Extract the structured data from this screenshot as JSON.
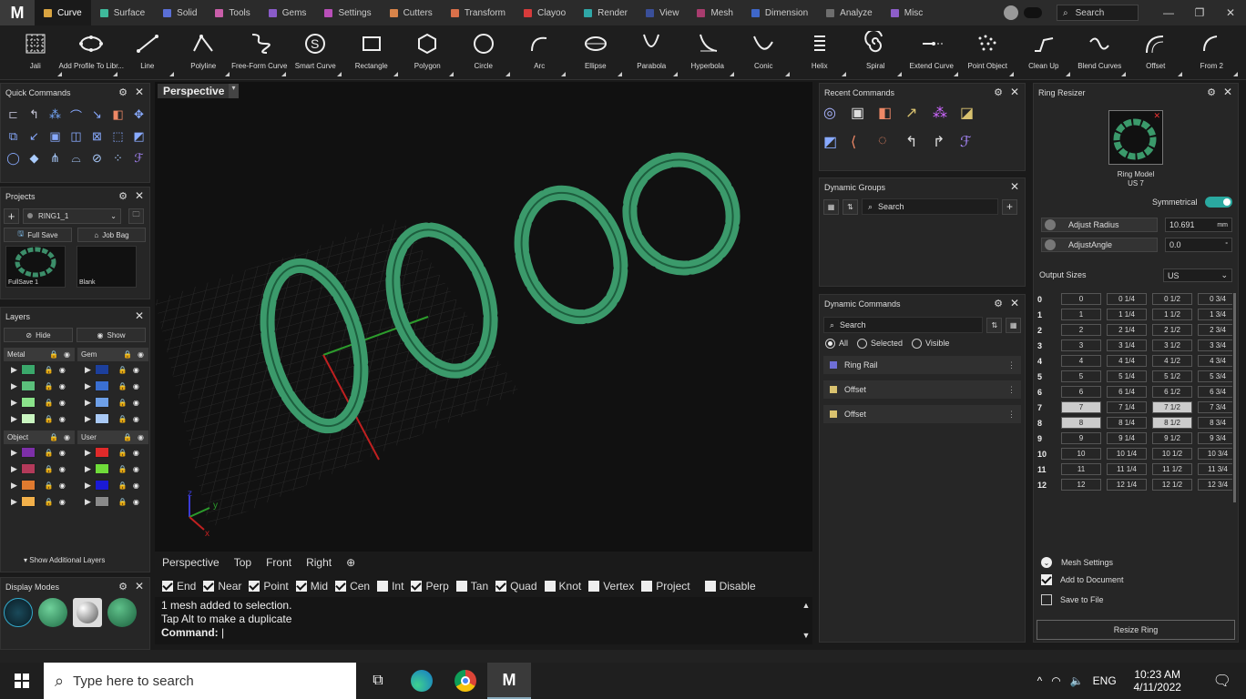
{
  "menubar": {
    "logo": "M",
    "tabs": [
      {
        "label": "Curve",
        "color": "#d9a441",
        "active": true
      },
      {
        "label": "Surface",
        "color": "#3fb99b"
      },
      {
        "label": "Solid",
        "color": "#5a6fd6"
      },
      {
        "label": "Tools",
        "color": "#c95ea9"
      },
      {
        "label": "Gems",
        "color": "#8a5bc9"
      },
      {
        "label": "Settings",
        "color": "#b94fb9"
      },
      {
        "label": "Cutters",
        "color": "#d9844a"
      },
      {
        "label": "Transform",
        "color": "#d9704a"
      },
      {
        "label": "Clayoo",
        "color": "#d63b3b"
      },
      {
        "label": "Render",
        "color": "#2fa7a7"
      },
      {
        "label": "View",
        "color": "#3a4f99"
      },
      {
        "label": "Mesh",
        "color": "#a83c6e"
      },
      {
        "label": "Dimension",
        "color": "#3f67c9"
      },
      {
        "label": "Analyze",
        "color": "#6e6e6e"
      },
      {
        "label": "Misc",
        "color": "#8d5ec9"
      }
    ],
    "search_label": "Search"
  },
  "toolbar": [
    {
      "label": "Jali",
      "icon": "jali-icon"
    },
    {
      "label": "Add Profile To Libr...",
      "icon": "add-profile-icon"
    },
    {
      "label": "Line",
      "icon": "line-icon"
    },
    {
      "label": "Polyline",
      "icon": "polyline-icon"
    },
    {
      "label": "Free-Form Curve",
      "icon": "freeform-curve-icon"
    },
    {
      "label": "Smart Curve",
      "icon": "smart-curve-icon"
    },
    {
      "label": "Rectangle",
      "icon": "rectangle-icon"
    },
    {
      "label": "Polygon",
      "icon": "polygon-icon"
    },
    {
      "label": "Circle",
      "icon": "circle-icon"
    },
    {
      "label": "Arc",
      "icon": "arc-icon"
    },
    {
      "label": "Ellipse",
      "icon": "ellipse-icon"
    },
    {
      "label": "Parabola",
      "icon": "parabola-icon"
    },
    {
      "label": "Hyperbola",
      "icon": "hyperbola-icon"
    },
    {
      "label": "Conic",
      "icon": "conic-icon"
    },
    {
      "label": "Helix",
      "icon": "helix-icon"
    },
    {
      "label": "Spiral",
      "icon": "spiral-icon"
    },
    {
      "label": "Extend Curve",
      "icon": "extend-curve-icon"
    },
    {
      "label": "Point Object",
      "icon": "point-object-icon"
    },
    {
      "label": "Clean Up",
      "icon": "clean-up-icon"
    },
    {
      "label": "Blend Curves",
      "icon": "blend-curves-icon"
    },
    {
      "label": "Offset",
      "icon": "offset-icon"
    },
    {
      "label": "From 2",
      "icon": "from2-icon"
    }
  ],
  "quick_commands": {
    "title": "Quick Commands"
  },
  "projects": {
    "title": "Projects",
    "project_name": "RING1_1",
    "full_save": "Full Save",
    "job_bag": "Job Bag",
    "thumbs": [
      "FullSave 1",
      "Blank"
    ]
  },
  "layers": {
    "title": "Layers",
    "hide": "Hide",
    "show": "Show",
    "groups": [
      {
        "name": "Metal",
        "colors": [
          "#3aa86b",
          "#5bbf7b",
          "#8be38b",
          "#c9f5c0"
        ]
      },
      {
        "name": "Gem",
        "colors": [
          "#1c3f9c",
          "#3a6fd1",
          "#6ea0e8",
          "#a9c9f5"
        ]
      },
      {
        "name": "Object",
        "colors": [
          "#7d2fa8",
          "#b33a5a",
          "#e07a2f",
          "#f2b04a"
        ]
      },
      {
        "name": "User",
        "colors": [
          "#e02a2a",
          "#6fdc3a",
          "#1a1ad6",
          "#8a8a8a"
        ]
      }
    ],
    "show_additional": "Show Additional Layers"
  },
  "display_modes": {
    "title": "Display Modes"
  },
  "viewport": {
    "label": "Perspective",
    "axis_labels": {
      "x": "x",
      "y": "y",
      "z": "z"
    },
    "tabs": [
      "Perspective",
      "Top",
      "Front",
      "Right"
    ]
  },
  "snaps": [
    {
      "label": "End",
      "on": true
    },
    {
      "label": "Near",
      "on": true
    },
    {
      "label": "Point",
      "on": true
    },
    {
      "label": "Mid",
      "on": true
    },
    {
      "label": "Cen",
      "on": true
    },
    {
      "label": "Int",
      "on": false
    },
    {
      "label": "Perp",
      "on": true
    },
    {
      "label": "Tan",
      "on": false
    },
    {
      "label": "Quad",
      "on": true
    },
    {
      "label": "Knot",
      "on": false
    },
    {
      "label": "Vertex",
      "on": false
    },
    {
      "label": "Project",
      "on": false
    },
    {
      "label": "Disable",
      "on": false
    }
  ],
  "console": {
    "line1": "1 mesh added to selection.",
    "line2": "Tap Alt to make a duplicate",
    "prompt": "Command:"
  },
  "recent_commands": {
    "title": "Recent Commands"
  },
  "dynamic_groups": {
    "title": "Dynamic Groups",
    "search_placeholder": "Search"
  },
  "dynamic_commands": {
    "title": "Dynamic Commands",
    "search_placeholder": "Search",
    "filter_all": "All",
    "filter_selected": "Selected",
    "filter_visible": "Visible",
    "items": [
      {
        "label": "Ring Rail",
        "color": "#6f6fd6"
      },
      {
        "label": "Offset",
        "color": "#d9c26f"
      },
      {
        "label": "Offset",
        "color": "#d9c26f"
      }
    ]
  },
  "ring_resizer": {
    "title": "Ring Resizer",
    "model_label": "Ring Model",
    "model_size": "US 7",
    "symmetrical": "Symmetrical",
    "adjust_radius": "Adjust Radius",
    "radius_value": "10.691",
    "radius_unit": "mm",
    "adjust_angle": "AdjustAngle",
    "angle_value": "0.0",
    "angle_unit": "°",
    "output_sizes": "Output Sizes",
    "unit_system": "US",
    "rows": [
      [
        "0",
        "0",
        "0 1/4",
        "0 1/2",
        "0 3/4"
      ],
      [
        "1",
        "1",
        "1 1/4",
        "1 1/2",
        "1 3/4"
      ],
      [
        "2",
        "2",
        "2 1/4",
        "2 1/2",
        "2 3/4"
      ],
      [
        "3",
        "3",
        "3 1/4",
        "3 1/2",
        "3 3/4"
      ],
      [
        "4",
        "4",
        "4 1/4",
        "4 1/2",
        "4 3/4"
      ],
      [
        "5",
        "5",
        "5 1/4",
        "5 1/2",
        "5 3/4"
      ],
      [
        "6",
        "6",
        "6 1/4",
        "6 1/2",
        "6 3/4"
      ],
      [
        "7",
        "7",
        "7 1/4",
        "7 1/2",
        "7 3/4"
      ],
      [
        "8",
        "8",
        "8 1/4",
        "8 1/2",
        "8 3/4"
      ],
      [
        "9",
        "9",
        "9 1/4",
        "9 1/2",
        "9 3/4"
      ],
      [
        "10",
        "10",
        "10 1/4",
        "10 1/2",
        "10 3/4"
      ],
      [
        "11",
        "11",
        "11 1/4",
        "11 1/2",
        "11 3/4"
      ],
      [
        "12",
        "12",
        "12 1/4",
        "12 1/2",
        "12 3/4"
      ]
    ],
    "selected": [
      "7",
      "7 1/2",
      "8",
      "8 1/2"
    ],
    "mesh_settings": "Mesh Settings",
    "add_to_document": "Add to Document",
    "save_to_file": "Save to File",
    "resize_button": "Resize Ring"
  },
  "taskbar": {
    "search_placeholder": "Type here to search",
    "lang": "ENG",
    "time": "10:23 AM",
    "date": "4/11/2022"
  }
}
